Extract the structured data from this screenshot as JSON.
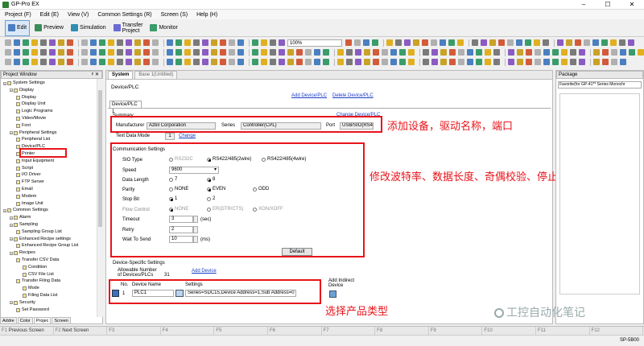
{
  "window": {
    "title": "GP-Pro EX"
  },
  "menu": [
    "Project (F)",
    "Edit (E)",
    "View (V)",
    "Common Settings (R)",
    "Screen (S)",
    "Help (H)"
  ],
  "modes": [
    {
      "label": "Edit",
      "color": "#4a7fc1"
    },
    {
      "label": "Preview",
      "color": "#3b8c5a"
    },
    {
      "label": "Simulation",
      "color": "#2f8fb0"
    },
    {
      "label": "Transfer\nProject",
      "color": "#6b6bd6"
    },
    {
      "label": "Monitor",
      "color": "#3a9c6a"
    }
  ],
  "toolbar": {
    "zoom": "100%"
  },
  "project_window": {
    "title": "Project Window",
    "tree": [
      {
        "label": "System Settings",
        "level": 0
      },
      {
        "label": "Display",
        "level": 1
      },
      {
        "label": "Display",
        "level": 2
      },
      {
        "label": "Display Unit",
        "level": 2
      },
      {
        "label": "Logic Programs",
        "level": 2
      },
      {
        "label": "Video/Movie",
        "level": 2
      },
      {
        "label": "Font",
        "level": 2
      },
      {
        "label": "Peripheral Settings",
        "level": 1
      },
      {
        "label": "Peripheral List",
        "level": 2
      },
      {
        "label": "Device/PLC",
        "level": 2
      },
      {
        "label": "Printer",
        "level": 2
      },
      {
        "label": "Input Equipment",
        "level": 2
      },
      {
        "label": "Script",
        "level": 2
      },
      {
        "label": "I/O Driver",
        "level": 2
      },
      {
        "label": "FTP Server",
        "level": 2
      },
      {
        "label": "Email",
        "level": 2
      },
      {
        "label": "Modem",
        "level": 2
      },
      {
        "label": "Image Unit",
        "level": 2
      },
      {
        "label": "Common Settings",
        "level": 0
      },
      {
        "label": "Alarm",
        "level": 1
      },
      {
        "label": "Sampling",
        "level": 1
      },
      {
        "label": "Sampling Group List",
        "level": 2
      },
      {
        "label": "Enhanced Recipe settings",
        "level": 1
      },
      {
        "label": "Enhanced Recipe Group List",
        "level": 2
      },
      {
        "label": "Recipes",
        "level": 1
      },
      {
        "label": "Transfer CSV Data",
        "level": 2
      },
      {
        "label": "Condition",
        "level": 3
      },
      {
        "label": "CSV File List",
        "level": 3
      },
      {
        "label": "Transfer Filing Data",
        "level": 2
      },
      {
        "label": "Mode",
        "level": 3
      },
      {
        "label": "Filing Data List",
        "level": 3
      },
      {
        "label": "Security",
        "level": 1
      },
      {
        "label": "Set Password",
        "level": 2
      }
    ],
    "tabs": [
      "Addre",
      "Color",
      "Projec",
      "Screen"
    ]
  },
  "doc_tabs": [
    "System",
    "Base 1(Untitled)"
  ],
  "device_plc": {
    "heading": "Device/PLC",
    "add_link": "Add Device/PLC",
    "delete_link": "Delete Device/PLC",
    "subtab": "Device/PLC 1",
    "summary_label": "Summary",
    "change_link": "Change Device/PLC",
    "manufacturer_label": "Manufacturer",
    "manufacturer": "Azbil Corporation",
    "series_label": "Series",
    "series": "Controller(CPL)",
    "port_label": "Port",
    "port": "USB/SIO(RS42",
    "text_data_mode_label": "Text Data Mode",
    "text_data_mode": "1",
    "text_data_change": "Change"
  },
  "comm": {
    "title": "Communication Settings",
    "sio_type_label": "SIO Type",
    "sio_options": [
      "RS232C",
      "RS422/485(2wire)",
      "RS422/485(4wire)"
    ],
    "speed_label": "Speed",
    "speed": "9600",
    "data_length_label": "Data Length",
    "data_length_options": [
      "7",
      "8"
    ],
    "parity_label": "Parity",
    "parity_options": [
      "NONE",
      "EVEN",
      "ODD"
    ],
    "stop_bit_label": "Stop Bit",
    "stop_bit_options": [
      "1",
      "2"
    ],
    "flow_control_label": "Flow Control",
    "flow_options": [
      "NONE",
      "ER(DTR/CTS)",
      "XON/XOFF"
    ],
    "timeout_label": "Timeout",
    "timeout": "3",
    "timeout_unit": "(sec)",
    "retry_label": "Retry",
    "retry": "2",
    "wait_label": "Wait To Send",
    "wait": "10",
    "wait_unit": "(ms)",
    "default_button": "Default"
  },
  "device_specific": {
    "title": "Device-Specific Settings",
    "allowable_label": "Allowable Number\nof Devices/PLCs",
    "allowable_value": "31",
    "add_device_link": "Add Device",
    "add_indirect_label": "Add Indirect\nDevice",
    "col_no": "No.",
    "col_name": "Device Name",
    "col_settings": "Settings",
    "row_no": "1",
    "row_name": "PLC1",
    "row_settings": "Series=SDC15,Device Address=1,Sub Address=0"
  },
  "annotations": {
    "a1": "添加设备，驱动名称，端口",
    "a2": "修改波特率、数据长度、奇偶校验、停止位",
    "a3": "选择产品类型",
    "color": "#e8141b"
  },
  "package": {
    "title": "Package",
    "dropdown": "Favorite(for GP-41** Series Monochr"
  },
  "fkeys": [
    "F1",
    "Previous Screen",
    "F2",
    "Next Screen",
    "F3",
    "F4",
    "F5",
    "F6",
    "F7",
    "F8",
    "F9",
    "F10",
    "F11",
    "F12"
  ],
  "status": {
    "model": "SP-5B00"
  },
  "watermark": "工控自动化笔记"
}
